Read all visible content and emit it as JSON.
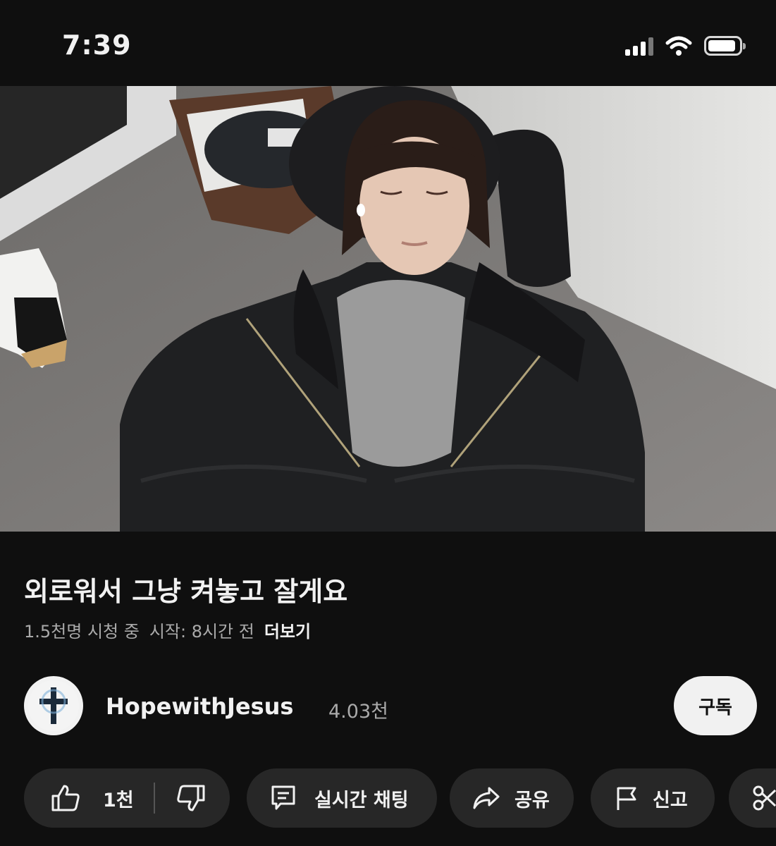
{
  "status_bar": {
    "time": "7:39"
  },
  "video": {
    "title": "외로워서 그냥 켜놓고 잘게요",
    "viewers": "1.5천명 시청 중",
    "started": "시작: 8시간 전",
    "more_label": "더보기"
  },
  "channel": {
    "name": "HopewithJesus",
    "subscribers": "4.03천",
    "subscribe_label": "구독"
  },
  "actions": {
    "like_count": "1천",
    "live_chat_label": "실시간 채팅",
    "share_label": "공유",
    "report_label": "신고"
  }
}
